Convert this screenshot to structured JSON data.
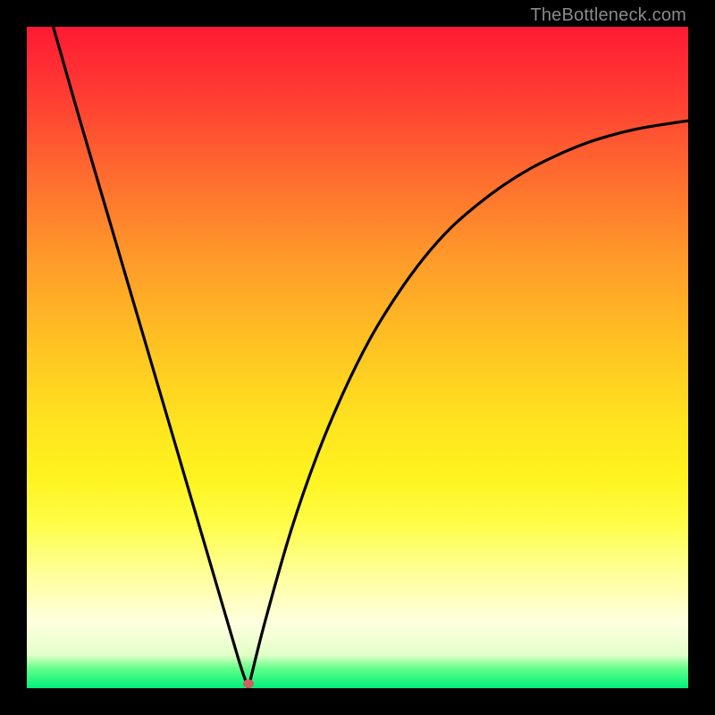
{
  "header": {
    "credit": "TheBottleneck.com"
  },
  "chart_data": {
    "type": "line",
    "title": "",
    "xlabel": "",
    "ylabel": "",
    "xlim": [
      0,
      100
    ],
    "ylim": [
      0,
      100
    ],
    "grid": false,
    "series": [
      {
        "name": "bottleneck-curve-left",
        "x": [
          4,
          8,
          12,
          16,
          20,
          24,
          28,
          32,
          33.5
        ],
        "values": [
          100,
          86,
          72.4,
          58.8,
          45.2,
          31.6,
          18,
          4.4,
          0
        ]
      },
      {
        "name": "bottleneck-curve-right",
        "x": [
          33.5,
          36,
          40,
          44,
          48,
          52,
          56,
          60,
          64,
          68,
          72,
          76,
          80,
          84,
          88,
          92,
          96,
          100
        ],
        "values": [
          0,
          10,
          24,
          35.5,
          45,
          53,
          59.5,
          65,
          69.5,
          73,
          76,
          78.5,
          80.5,
          82.2,
          83.5,
          84.5,
          85.2,
          85.8
        ]
      }
    ],
    "marker": {
      "x": 33.5,
      "y": 0.7,
      "color": "#d06060"
    },
    "gradient_stops": [
      {
        "pct": 0,
        "color": "#ff1a33"
      },
      {
        "pct": 10,
        "color": "#ff3b33"
      },
      {
        "pct": 22,
        "color": "#ff6a2f"
      },
      {
        "pct": 35,
        "color": "#ff9a2a"
      },
      {
        "pct": 48,
        "color": "#ffc223"
      },
      {
        "pct": 60,
        "color": "#ffe41f"
      },
      {
        "pct": 68,
        "color": "#fff31f"
      },
      {
        "pct": 75,
        "color": "#fffd46"
      },
      {
        "pct": 82,
        "color": "#ffff93"
      },
      {
        "pct": 90,
        "color": "#ffffe0"
      },
      {
        "pct": 95,
        "color": "#e2ffc8"
      },
      {
        "pct": 97,
        "color": "#63ff8a"
      },
      {
        "pct": 100,
        "color": "#00f07a"
      }
    ]
  },
  "colors": {
    "frame": "#000000",
    "curve": "#000000",
    "credit_text": "#8a8a8a",
    "marker": "#d06060"
  }
}
